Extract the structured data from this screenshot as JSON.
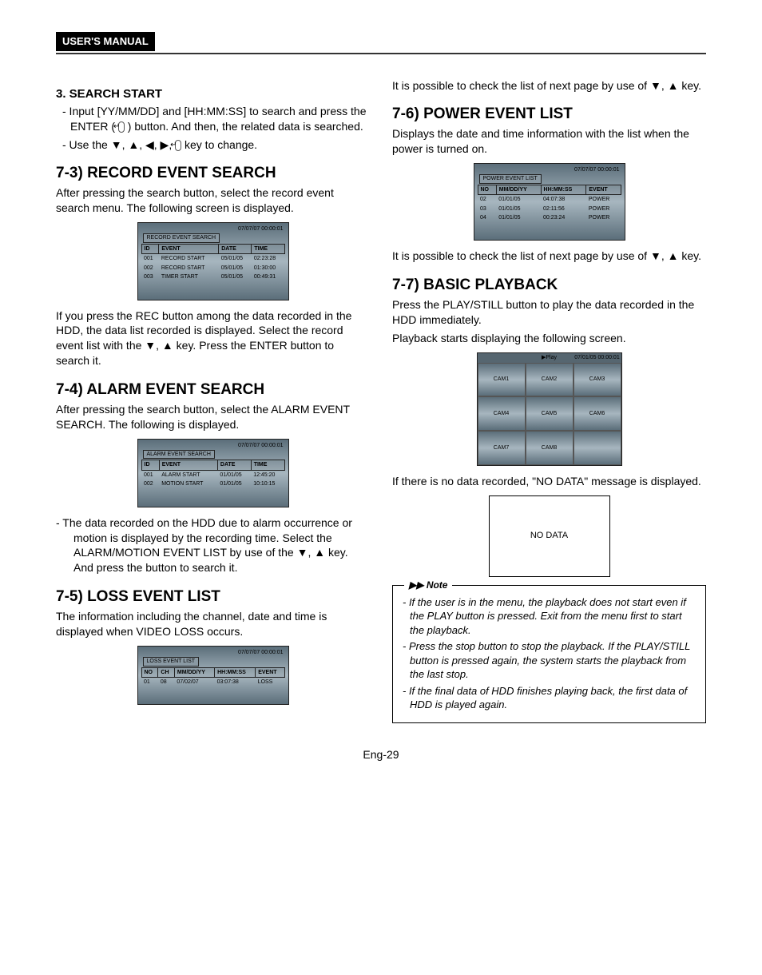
{
  "header": {
    "manual": "USER'S MANUAL"
  },
  "left": {
    "s3": {
      "title": "3. SEARCH START",
      "l1": "- Input [YY/MM/DD] and [HH:MM:SS] to search and press the ENTER (",
      "l1b": ") button. And then, the related data is searched.",
      "l2a": "- Use the  ",
      "l2b": " key to change."
    },
    "s73": {
      "title": "7-3) RECORD EVENT SEARCH",
      "p1": "After pressing the search button, select the record event search menu. The following screen is displayed.",
      "screen_ts": "07/07/07  00:00:01",
      "screen_title": "RECORD EVENT SEARCH",
      "cols": [
        "ID",
        "EVENT",
        "DATE",
        "TIME"
      ],
      "rows": [
        [
          "001",
          "RECORD START",
          "05/01/05",
          "02:23:28"
        ],
        [
          "002",
          "RECORD START",
          "05/01/05",
          "01:30:00"
        ],
        [
          "003",
          "TIMER  START",
          "05/01/05",
          "00:49:31"
        ]
      ],
      "p2a": "If you press the REC button among the data recorded in the HDD, the data list recorded is displayed. Select the record event list with the ",
      "p2b": " key. Press the ENTER button to search it."
    },
    "s74": {
      "title": "7-4) ALARM EVENT SEARCH",
      "p1": "After pressing the search button, select the ALARM EVENT SEARCH. The following is displayed.",
      "screen_ts": "07/07/07  00:00:01",
      "screen_title": "ALARM EVENT SEARCH",
      "cols": [
        "ID",
        "EVENT",
        "DATE",
        "TIME"
      ],
      "rows": [
        [
          "001",
          "ALARM START",
          "01/01/05",
          "12:45:20"
        ],
        [
          "002",
          "MOTION START",
          "01/01/05",
          "10:10:15"
        ]
      ],
      "p2a": "-   The data recorded on the HDD due to alarm occurrence or motion is displayed by the recording time. Select the ALARM/MOTION EVENT LIST by use of the  ",
      "p2b": " key. And press the button to search it."
    },
    "s75": {
      "title": "7-5) LOSS EVENT LIST",
      "p1": "The information including the channel, date and time is displayed when VIDEO LOSS occurs.",
      "screen_ts": "07/07/07  00:00:01",
      "screen_title": "LOSS EVENT LIST",
      "cols": [
        "NO",
        "CH",
        "MM/DD/YY",
        "HH:MM:SS",
        "EVENT"
      ],
      "rows": [
        [
          "01",
          "08",
          "07/02/07",
          "03:07:38",
          "LOSS"
        ]
      ]
    }
  },
  "right": {
    "top": {
      "p1a": "It is possible to check the list of next page by use of  ",
      "p1b": " key."
    },
    "s76": {
      "title": "7-6) POWER EVENT LIST",
      "p1": "Displays the date and time information with the list when the power is turned on.",
      "screen_ts": "07/07/07  00:00:01",
      "screen_title": "POWER EVENT LIST",
      "cols": [
        "NO",
        "MM/DD/YY",
        "HH:MM:SS",
        "EVENT"
      ],
      "rows": [
        [
          "02",
          "01/01/05",
          "04:07:38",
          "POWER"
        ],
        [
          "03",
          "01/01/05",
          "02:11:56",
          "POWER"
        ],
        [
          "04",
          "01/01/05",
          "00:23:24",
          "POWER"
        ]
      ],
      "p2a": "It is possible to check the list of next page by use of ",
      "p2b": " key."
    },
    "s77": {
      "title": "7-7) BASIC PLAYBACK",
      "p1": "Press the PLAY/STILL button to play the data recorded in the HDD immediately.",
      "p2": "Playback starts displaying the following screen.",
      "grid_top": [
        "",
        "▶Play",
        "07/01/05 00:00:01"
      ],
      "grid_cells": [
        "CAM1",
        "CAM2",
        "CAM3",
        "CAM4",
        "CAM5",
        "CAM6",
        "CAM7",
        "CAM8",
        ""
      ],
      "p3": "If there is no data recorded, \"NO DATA\" message is displayed.",
      "nodata": "NO DATA"
    },
    "note": {
      "label": "Note",
      "items": [
        "-  If the user is in the menu, the playback does not start even if the PLAY button is pressed. Exit from the menu first to start the playback.",
        "-  Press the stop button to stop the playback. If the PLAY/STILL button is pressed again, the system starts the playback from the last stop.",
        "- If the final data of HDD finishes playing back, the first data of HDD is played again."
      ]
    }
  },
  "page": "Eng-29"
}
